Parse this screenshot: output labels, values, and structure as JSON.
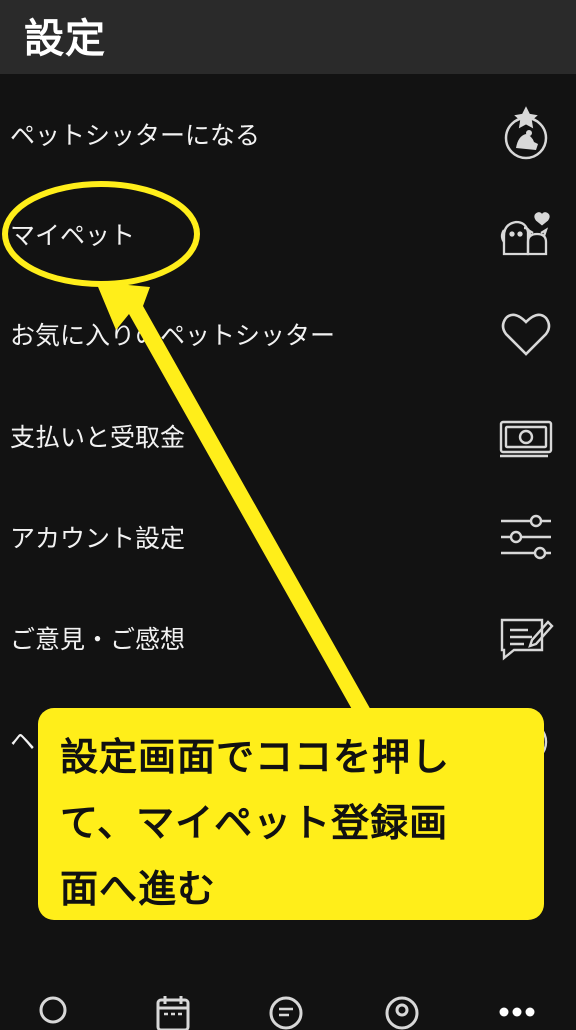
{
  "header": {
    "title": "設定"
  },
  "menu": {
    "items": [
      {
        "label": "ペットシッターになる",
        "icon": "pet-sitter-badge-icon"
      },
      {
        "label": "マイペット",
        "icon": "pets-icon"
      },
      {
        "label": "お気に入りのペットシッター",
        "icon": "heart-icon"
      },
      {
        "label": "支払いと受取金",
        "icon": "money-icon"
      },
      {
        "label": "アカウント設定",
        "icon": "sliders-icon"
      },
      {
        "label": "ご意見・ご感想",
        "icon": "feedback-icon"
      },
      {
        "label": "ヘ",
        "icon": "help-icon"
      }
    ]
  },
  "annotation": {
    "lines": [
      "設定画面でココを押し",
      "て、マイペット登録画",
      "面へ進む"
    ],
    "color": "#ffee1a"
  },
  "bottom_nav": {
    "items": [
      {
        "icon": "search-icon"
      },
      {
        "icon": "calendar-icon"
      },
      {
        "icon": "chat-icon"
      },
      {
        "icon": "profile-icon"
      },
      {
        "icon": "more-icon"
      }
    ]
  }
}
